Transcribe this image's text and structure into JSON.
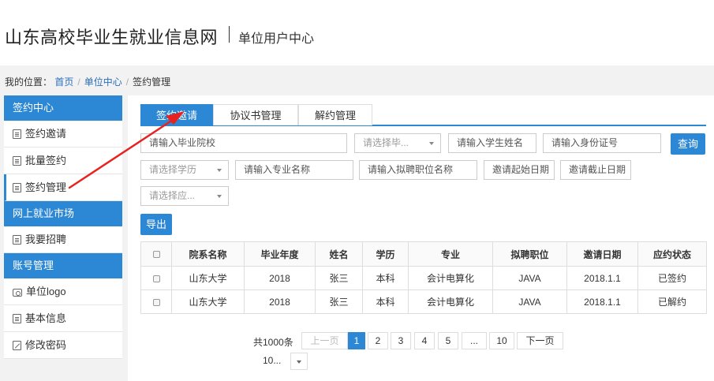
{
  "header": {
    "site_title": "山东高校毕业生就业信息网",
    "center_title": "单位用户中心"
  },
  "breadcrumb": {
    "label": "我的位置：",
    "items": [
      "首页",
      "单位中心",
      "签约管理"
    ]
  },
  "sidebar": {
    "sections": [
      {
        "title": "签约中心",
        "items": [
          {
            "label": "签约邀请",
            "icon": "document-icon"
          },
          {
            "label": "批量签约",
            "icon": "document-icon"
          },
          {
            "label": "签约管理",
            "icon": "document-icon",
            "active": true
          }
        ]
      },
      {
        "title": "网上就业市场",
        "items": [
          {
            "label": "我要招聘",
            "icon": "list-icon"
          }
        ]
      },
      {
        "title": "账号管理",
        "items": [
          {
            "label": "单位logo",
            "icon": "camera-icon"
          },
          {
            "label": "基本信息",
            "icon": "list-icon"
          },
          {
            "label": "修改密码",
            "icon": "edit-icon"
          }
        ]
      }
    ]
  },
  "tabs": [
    "签约邀请",
    "协议书管理",
    "解约管理"
  ],
  "filters": {
    "school": "请输入毕业院校",
    "graduation_year": "请选择毕...",
    "student_name": "请输入学生姓名",
    "id_number": "请输入身份证号",
    "query_button": "查询",
    "education": "请选择学历",
    "major": "请输入专业名称",
    "position": "请输入拟聘职位名称",
    "start_date": "邀请起始日期",
    "end_date": "邀请截止日期",
    "status": "请选择应...",
    "export_button": "导出"
  },
  "table": {
    "columns": [
      "院系名称",
      "毕业年度",
      "姓名",
      "学历",
      "专业",
      "拟聘职位",
      "邀请日期",
      "应约状态"
    ],
    "rows": [
      [
        "山东大学",
        "2018",
        "张三",
        "本科",
        "会计电算化",
        "JAVA",
        "2018.1.1",
        "已签约"
      ],
      [
        "山东大学",
        "2018",
        "张三",
        "本科",
        "会计电算化",
        "JAVA",
        "2018.1.1",
        "已解约"
      ]
    ]
  },
  "pagination": {
    "total": "共1000条",
    "prev": "上一页",
    "pages": [
      "1",
      "2",
      "3",
      "4",
      "5",
      "...",
      "10"
    ],
    "current": "1",
    "next": "下一页",
    "page_size": "10..."
  },
  "colors": {
    "primary": "#2c87d4",
    "annotation": "#e8231f"
  }
}
